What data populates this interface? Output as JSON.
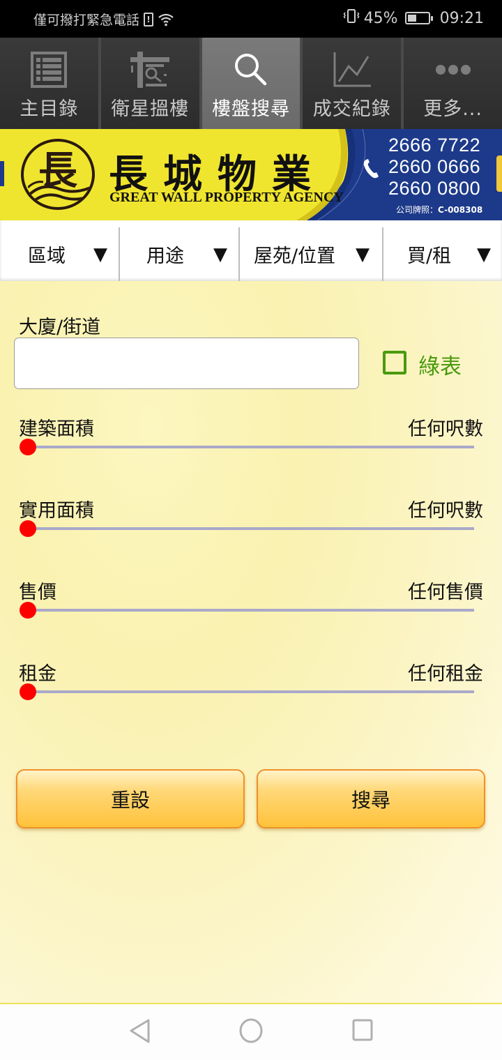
{
  "status_bar": {
    "carrier_text": "僅可撥打緊急電話",
    "sim_icon": "sim-alert-icon",
    "wifi_icon": "wifi-icon",
    "vibrate_icon": "vibrate-icon",
    "battery_percent": "45%",
    "battery_level": 0.45,
    "time": "09:21"
  },
  "top_nav": {
    "tabs": [
      {
        "label": "主目錄",
        "icon": "list-icon",
        "active": false
      },
      {
        "label": "衛星搵樓",
        "icon": "satellite-search-icon",
        "active": false
      },
      {
        "label": "樓盤搜尋",
        "icon": "search-icon",
        "active": true
      },
      {
        "label": "成交紀錄",
        "icon": "line-chart-icon",
        "active": false
      },
      {
        "label": "更多...",
        "icon": "more-dots-icon",
        "active": false
      }
    ]
  },
  "banner": {
    "logo_char": "長",
    "brand_cn": "長城物業",
    "brand_en": "GREAT WALL PROPERTY AGENCY",
    "phones": [
      "2666 7722",
      "2660 0666",
      "2660 0800"
    ],
    "license_label": "公司牌照：",
    "license_no": "C-008308",
    "colors": {
      "yellow": "#f0e52e",
      "navy": "#1d3a8a"
    }
  },
  "filters": [
    {
      "label": "區域",
      "arrow": "▼"
    },
    {
      "label": "用途",
      "arrow": "▼"
    },
    {
      "label": "屋苑/位置",
      "arrow": "▼"
    },
    {
      "label": "買/租",
      "arrow": "▼"
    }
  ],
  "form": {
    "building_label": "大廈/街道",
    "building_value": "",
    "building_placeholder": "",
    "green_form_label": "綠表",
    "green_form_checked": false,
    "sliders": [
      {
        "label": "建築面積",
        "value_text": "任何呎數",
        "position": 0
      },
      {
        "label": "實用面積",
        "value_text": "任何呎數",
        "position": 0
      },
      {
        "label": "售價",
        "value_text": "任何售價",
        "position": 0
      },
      {
        "label": "租金",
        "value_text": "任何租金",
        "position": 0
      }
    ],
    "reset_label": "重設",
    "search_label": "搜尋"
  },
  "nav_bar": {
    "back_icon": "back-triangle-icon",
    "home_icon": "home-circle-icon",
    "recents_icon": "recents-square-icon"
  }
}
